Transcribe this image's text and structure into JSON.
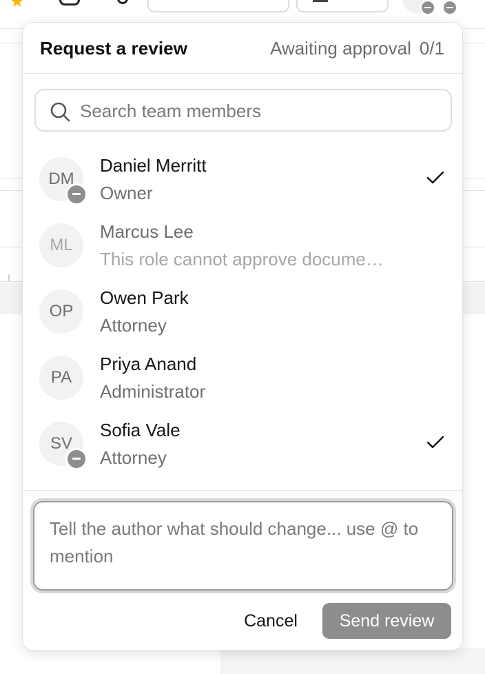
{
  "popover": {
    "title": "Request a review",
    "status_label": "Awaiting approval",
    "status_count": "0/1"
  },
  "search": {
    "placeholder": "Search team members",
    "value": ""
  },
  "members": [
    {
      "initials": "DM",
      "name": "Daniel Merritt",
      "role": "Owner",
      "selected": true,
      "badge": "minus-badge"
    },
    {
      "initials": "ML",
      "name": "Marcus Lee",
      "role": "This role cannot approve docume…",
      "selected": false,
      "disabled": true
    },
    {
      "initials": "OP",
      "name": "Owen Park",
      "role": "Attorney",
      "selected": false
    },
    {
      "initials": "PA",
      "name": "Priya Anand",
      "role": "Administrator",
      "selected": false
    },
    {
      "initials": "SV",
      "name": "Sofia Vale",
      "role": "Attorney",
      "selected": true,
      "badge": "minus-badge"
    }
  ],
  "comment": {
    "placeholder": "Tell the author what should change... use @ to mention",
    "value": ""
  },
  "actions": {
    "cancel_label": "Cancel",
    "send_label": "Send review"
  },
  "icons": {
    "search": "search-icon",
    "check": "check-icon",
    "badge": "minus-circle-icon"
  },
  "colors": {
    "send_button_disabled": "#8d8d8d",
    "badge": "#8e8e8e",
    "avatar_bg": "#f2f2f2",
    "accent_star": "#f5b800"
  }
}
